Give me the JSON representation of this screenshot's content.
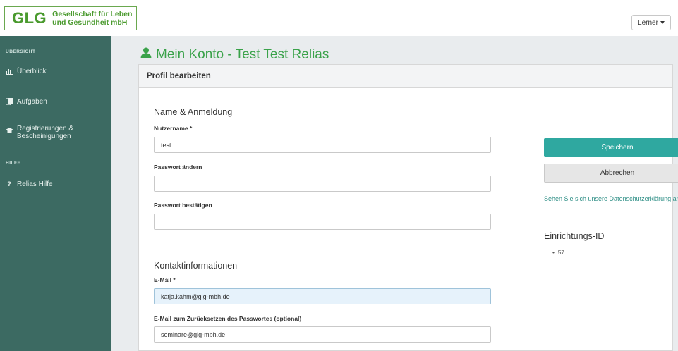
{
  "header": {
    "logo_mark": "GLG",
    "logo_line1": "Gesellschaft für Leben",
    "logo_line2": "und Gesundheit mbH",
    "role_button": "Lerner"
  },
  "sidebar": {
    "section1": "ÜBERSICHT",
    "items1": [
      {
        "label": "Überblick",
        "icon": "bar-chart-icon"
      },
      {
        "label": "Aufgaben",
        "icon": "tasks-icon"
      },
      {
        "label": "Registrierungen &",
        "label2": "Bescheinigungen",
        "icon": "graduation-icon"
      }
    ],
    "section2": "HILFE",
    "items2": [
      {
        "label": "Relias Hilfe",
        "icon": "question-icon"
      }
    ]
  },
  "page": {
    "title": "Mein Konto - Test Test Relias",
    "card_header": "Profil bearbeiten"
  },
  "form": {
    "section_login": "Name & Anmeldung",
    "username_label": "Nutzername *",
    "username_value": "test",
    "password_label": "Passwort ändern",
    "password_value": "",
    "confirm_label": "Passwort bestätigen",
    "confirm_value": "",
    "section_contact": "Kontaktinformationen",
    "email_label": "E-Mail *",
    "email_value": "katja.kahm@glg-mbh.de",
    "reset_email_label": "E-Mail zum Zurücksetzen des Passwortes (optional)",
    "reset_email_value": "seminare@glg-mbh.de"
  },
  "actions": {
    "save": "Speichern",
    "cancel": "Abbrechen",
    "privacy": "Sehen Sie sich unsere Datenschutzerklärung an",
    "facility_title": "Einrichtungs-ID",
    "facility_ids": [
      "57"
    ]
  },
  "colors": {
    "accent": "#2fa8a0",
    "sidebar": "#3c6a62",
    "title_green": "#3aa24a"
  }
}
